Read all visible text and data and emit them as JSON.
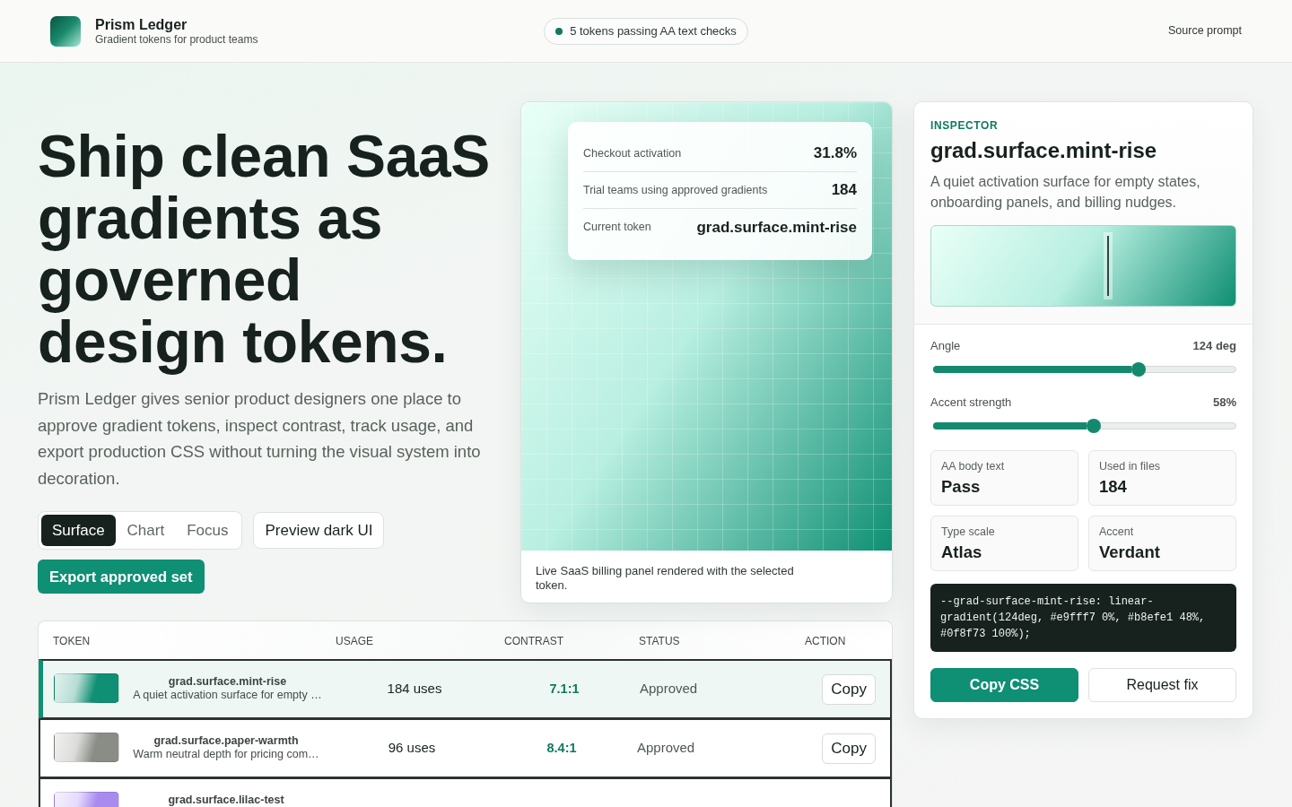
{
  "header": {
    "brand": "Prism Ledger",
    "tagline": "Gradient tokens for product teams",
    "status_pill": "5 tokens passing AA text checks",
    "link": "Source prompt"
  },
  "hero": {
    "headline": "Ship clean SaaS gradients as governed design tokens.",
    "intro": "Prism Ledger gives senior product designers one place to approve gradient tokens, inspect contrast, track usage, and export production CSS without turning the visual system into decoration.",
    "view_tabs": [
      {
        "label": "Surface",
        "selected": true
      },
      {
        "label": "Chart",
        "selected": false
      },
      {
        "label": "Focus",
        "selected": false
      }
    ],
    "secondary_button": "Preview dark UI",
    "primary_button": "Export approved set"
  },
  "preview": {
    "metrics": [
      {
        "label": "Checkout activation",
        "value": "31.8%"
      },
      {
        "label": "Trial teams using approved gradients",
        "value": "184"
      },
      {
        "label": "Current token",
        "value": "grad.surface.mint-rise"
      }
    ],
    "caption": "Live SaaS billing panel rendered with the selected token."
  },
  "table": {
    "columns": [
      "TOKEN",
      "USAGE",
      "CONTRAST",
      "STATUS",
      "ACTION"
    ],
    "rows": [
      {
        "token": "grad.surface.mint-rise",
        "description": "A quiet activation surface for empty …",
        "usage": "184 uses",
        "contrast": "7.1:1",
        "status": "Approved",
        "action": "Copy",
        "selected": true,
        "color": "#0f8f73"
      },
      {
        "token": "grad.surface.paper-warmth",
        "description": "Warm neutral depth for pricing com…",
        "usage": "96 uses",
        "contrast": "8.4:1",
        "status": "Approved",
        "action": "Copy",
        "selected": false,
        "color": "#8a8d86"
      },
      {
        "token": "grad.surface.lilac-test",
        "selected": false,
        "color": "#a98bf0"
      }
    ]
  },
  "inspector": {
    "eyebrow": "INSPECTOR",
    "title": "grad.surface.mint-rise",
    "description": "A quiet activation surface for empty states, onboarding panels, and billing nudges.",
    "gradient_stop": {
      "level": 0.58
    },
    "sliders": [
      {
        "label": "Angle",
        "reading": "124 deg",
        "level": 0.68
      },
      {
        "label": "Accent strength",
        "reading": "58%",
        "level": 0.53
      }
    ],
    "stats": [
      {
        "label": "AA body text",
        "value": "Pass"
      },
      {
        "label": "Used in files",
        "value": "184"
      },
      {
        "label": "Type scale",
        "value": "Atlas"
      },
      {
        "label": "Accent",
        "value": "Verdant"
      }
    ],
    "css": "--grad-surface-mint-rise: linear-gradient(124deg, #e9fff7 0%, #b8efe1 48%, #0f8f73 100%);",
    "buttons": [
      {
        "label": "Copy CSS",
        "kind": "primary"
      },
      {
        "label": "Request fix",
        "kind": "secondary"
      }
    ]
  }
}
